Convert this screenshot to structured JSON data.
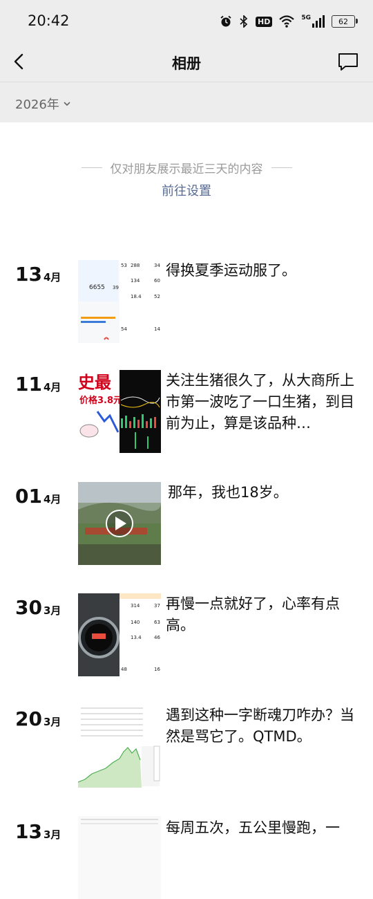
{
  "status_bar": {
    "time": "20:42",
    "battery": "62",
    "hd": "HD",
    "net": "5G"
  },
  "nav": {
    "title": "相册"
  },
  "year_select": {
    "label": "2026年"
  },
  "notice": {
    "text": "仅对朋友展示最近三天的内容",
    "link": "前往设置"
  },
  "thumb_texts": {
    "stats": [
      "53",
      "288",
      "34",
      "6655",
      "39",
      "134",
      "60",
      "18.4",
      "52",
      "54",
      "14"
    ],
    "stats2": [
      "314",
      "37",
      "140",
      "63",
      "13.4",
      "46",
      "48",
      "16"
    ],
    "pig": [
      "史最",
      "价格3.8元"
    ]
  },
  "entries": [
    {
      "day": "13",
      "month": "4月",
      "caption": "得换夏季运动服了。",
      "thumb": "stats"
    },
    {
      "day": "11",
      "month": "4月",
      "caption": "关注生猪很久了，从大商所上市第一波吃了一口生猪，到目前为止，算是该品种…",
      "thumb": "pig"
    },
    {
      "day": "01",
      "month": "4月",
      "caption": "那年，我也18岁。",
      "thumb": "video"
    },
    {
      "day": "30",
      "month": "3月",
      "caption": "再慢一点就好了，心率有点高。",
      "thumb": "watch"
    },
    {
      "day": "20",
      "month": "3月",
      "caption": "遇到这种一字断魂刀咋办？当然是骂它了。QTMD。",
      "thumb": "chart"
    },
    {
      "day": "13",
      "month": "3月",
      "caption": "每周五次，五公里慢跑，一",
      "thumb": "table"
    }
  ],
  "colors": {
    "bar_bg": "#ededed",
    "link": "#576b95",
    "muted": "#9a9a9a"
  },
  "icons": [
    "back-arrow-icon",
    "comment-icon",
    "chevron-down-icon",
    "alarm-icon",
    "bluetooth-icon",
    "wifi-icon",
    "signal-icon",
    "play-icon"
  ]
}
